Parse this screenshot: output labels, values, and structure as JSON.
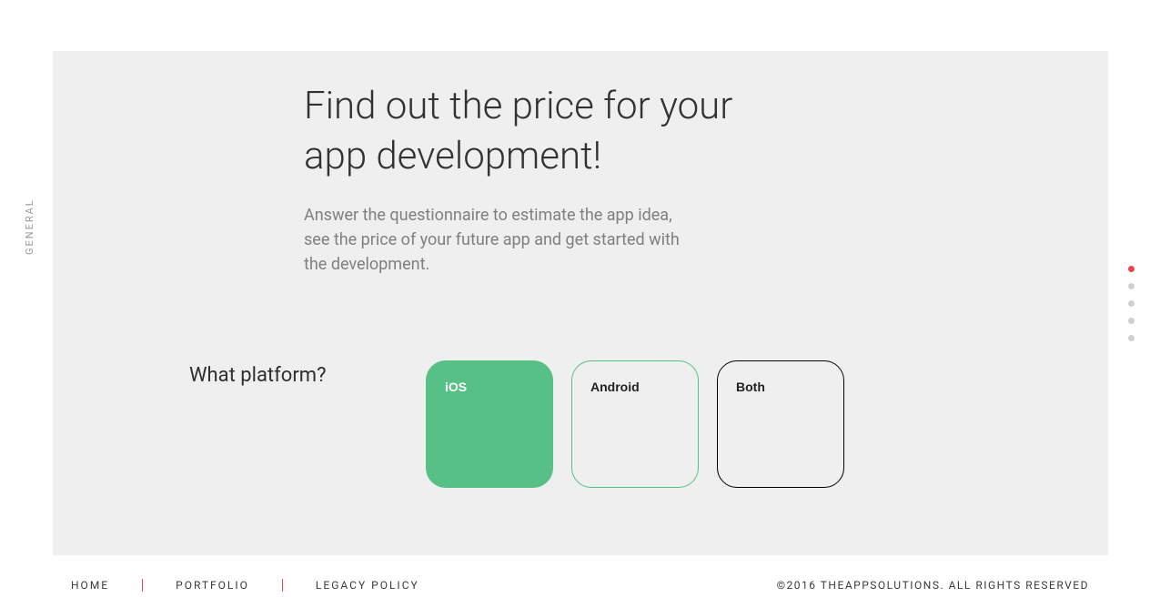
{
  "side_label": "GENERAL",
  "headline": "Find out the price for your app development!",
  "subhead": "Answer the questionnaire to estimate the app idea, see the price of your future app and get started with the development.",
  "question": {
    "label": "What platform?",
    "options": [
      {
        "label": "iOS",
        "selected": true,
        "alt": false
      },
      {
        "label": "Android",
        "selected": false,
        "alt": true
      },
      {
        "label": "Both",
        "selected": false,
        "alt": false
      }
    ]
  },
  "progress": {
    "total": 5,
    "active_index": 0
  },
  "footer": {
    "nav": [
      "HOME",
      "PORTFOLIO",
      "LEGACY POLICY"
    ],
    "copyright": "©2016 THEAPPSOLUTIONS. ALL RIGHTS RESERVED"
  }
}
